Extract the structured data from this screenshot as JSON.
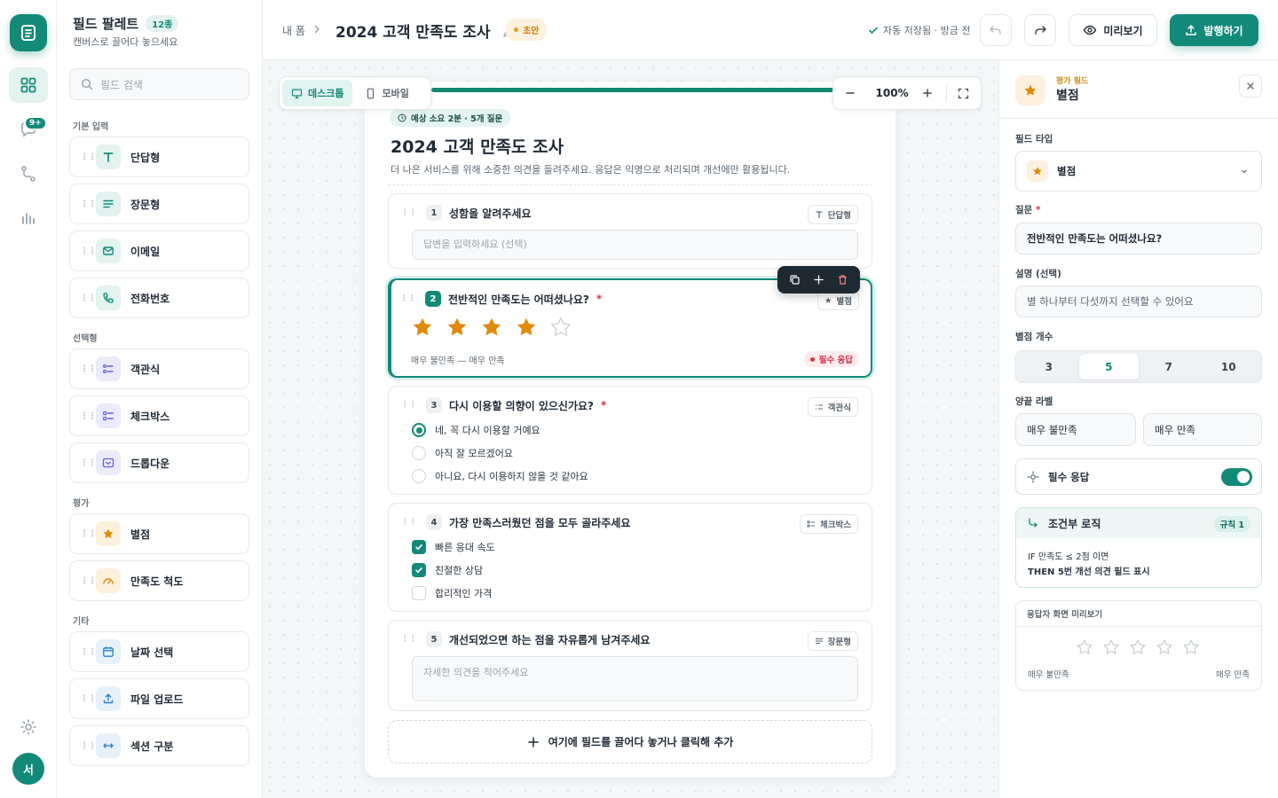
{
  "rail": {
    "notif_badge": "9+",
    "avatar_initial": "서"
  },
  "palette": {
    "title": "필드 팔레트",
    "count": "12종",
    "subtitle": "캔버스로 끌어다 놓으세요",
    "search_placeholder": "필드 검색",
    "groups": {
      "basic": "기본 입력",
      "choice": "선택형",
      "rating": "평가",
      "other": "기타"
    },
    "items": [
      "단답형",
      "장문형",
      "이메일",
      "전화번호",
      "객관식",
      "체크박스",
      "드롭다운",
      "별점",
      "만족도 척도",
      "날짜 선택",
      "파일 업로드",
      "섹션 구분"
    ]
  },
  "topbar": {
    "breadcrumb": "내 폼",
    "title": "2024 고객 만족도 조사",
    "status": "초안",
    "saved": "자동 저장됨 · 방금 전",
    "preview": "미리보기",
    "publish": "발행하기"
  },
  "canvas": {
    "device_desktop": "데스크톱",
    "device_mobile": "모바일",
    "zoom": "100%",
    "add_zone": "여기에 필드를 끌어다 놓거나 클릭해 추가"
  },
  "form": {
    "estimate": "예상 소요 2분 · 5개 질문",
    "title": "2024 고객 만족도 조사",
    "description": "더 나은 서비스를 위해 소중한 의견을 들려주세요. 응답은 익명으로 처리되며 개선에만 활용됩니다.",
    "q1": {
      "num": "1",
      "title": "성함을 알려주세요",
      "type": "단답형",
      "placeholder": "답변을 입력하세요 (선택)"
    },
    "q2": {
      "num": "2",
      "title": "전반적인 만족도는 어떠셨나요?",
      "type": "별점",
      "scale": "매우 불만족 — 매우 만족",
      "required": "필수 응답",
      "stars_filled": 4,
      "stars_total": 5
    },
    "q3": {
      "num": "3",
      "title": "다시 이용할 의향이 있으신가요?",
      "type": "객관식",
      "options": [
        "네, 꼭 다시 이용할 거예요",
        "아직 잘 모르겠어요",
        "아니요, 다시 이용하지 않을 것 같아요"
      ]
    },
    "q4": {
      "num": "4",
      "title": "가장 만족스러웠던 점을 모두 골라주세요",
      "type": "체크박스",
      "options": [
        "빠른 응대 속도",
        "친절한 상담",
        "합리적인 가격"
      ]
    },
    "q5": {
      "num": "5",
      "title": "개선되었으면 하는 점을 자유롭게 남겨주세요",
      "type": "장문형",
      "placeholder": "자세한 의견을 적어주세요"
    }
  },
  "props": {
    "kind": "평가 필드",
    "name": "별점",
    "field_type_label": "필드 타입",
    "field_type": "별점",
    "question_label": "질문",
    "question": "전반적인 만족도는 어떠셨나요?",
    "desc_label": "설명 (선택)",
    "desc": "별 하나부터 다섯까지 선택할 수 있어요",
    "count_label": "별점 개수",
    "counts": [
      "3",
      "5",
      "7",
      "10"
    ],
    "ends_label": "양끝 라벨",
    "end_low": "매우 불만족",
    "end_high": "매우 만족",
    "required": "필수 응답",
    "logic_title": "조건부 로직",
    "logic_rule": "규칙 1",
    "logic_if": "IF 만족도 ≤ 2점 이면",
    "logic_then": "THEN 5번 개선 의견 필드 표시",
    "preview_title": "응답자 화면 미리보기",
    "preview_low": "매우 불만족",
    "preview_high": "매우 만족"
  },
  "colors": {
    "accent": "#138a78",
    "star": "#e08a0b",
    "required": "#d6334a"
  }
}
